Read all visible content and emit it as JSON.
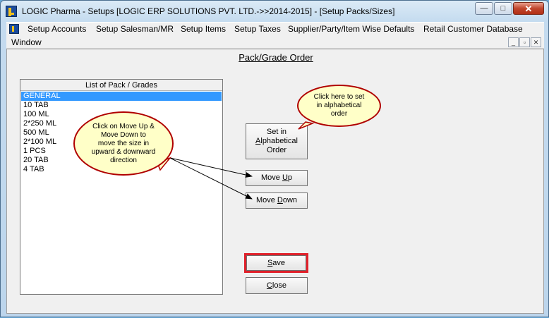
{
  "window": {
    "title": "LOGIC Pharma - Setups  [LOGIC ERP SOLUTIONS PVT. LTD.->>2014-2015] - [Setup Packs/Sizes]",
    "minimize_glyph": "—",
    "maximize_glyph": "□",
    "close_glyph": "✕",
    "icon": "logic-app-icon"
  },
  "menu": {
    "items": [
      "Setup Accounts",
      "Setup Salesman/MR",
      "Setup Items",
      "Setup Taxes",
      "Supplier/Party/Item Wise Defaults",
      "Retail Customer Database"
    ],
    "window_label": "Window",
    "mdi_minimize": "_",
    "mdi_restore": "▫",
    "mdi_close": "✕"
  },
  "form": {
    "title": "Pack/Grade Order",
    "list_header": "List of Pack / Grades",
    "items": [
      "GENERAL",
      "10 TAB",
      "100 ML",
      "2*250 ML",
      "500 ML",
      "2*100 ML",
      "1 PCS",
      "20 TAB",
      "4 TAB"
    ],
    "selected_item": "GENERAL"
  },
  "buttons": {
    "alpha_1": "Set in",
    "alpha_2a": "A",
    "alpha_2b": "lphabetical",
    "alpha_3": "Order",
    "move_up_a": "Move ",
    "move_up_b": "U",
    "move_up_c": "p",
    "move_down_a": "Move ",
    "move_down_b": "D",
    "move_down_c": "own",
    "save_a": "S",
    "save_b": "ave",
    "close_a": "C",
    "close_b": "lose"
  },
  "callouts": {
    "move_line1": "Click on Move Up &",
    "move_line2": "Move Down to",
    "move_line3": "move the size in",
    "move_line4": "upward & downward",
    "move_line5": "direction",
    "alpha_line1": "Click here to set",
    "alpha_line2": "in alphabetical",
    "alpha_line3": "order"
  },
  "colors": {
    "selection": "#3399ff",
    "highlight_frame": "#e0202a",
    "callout_fill": "#ffffc8",
    "callout_border": "#b00000"
  }
}
